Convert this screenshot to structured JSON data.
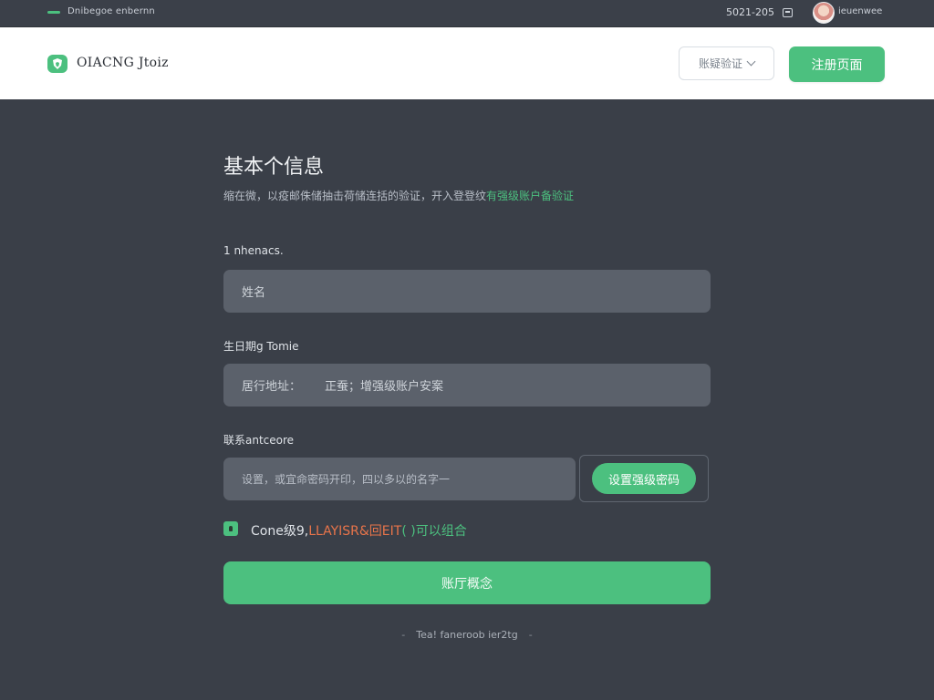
{
  "status_bar": {
    "left_text": "Dnibegoe enbernn",
    "time": "5021-205",
    "user": "ieuenwee"
  },
  "header": {
    "logo_text": "OIACNG Jtoiz",
    "verify_select": "账疑验证",
    "register_button": "注册页面"
  },
  "form": {
    "title": "基本个信息",
    "subtitle_prefix": "缩在微，以疫邮侏储抽击荷储连括的验证，开入登登纹",
    "subtitle_link": "有强级账户备验证",
    "name_label": "1 nhenacs.",
    "name_placeholder": "姓名",
    "address_label": "生日期g Tomie",
    "address_prefix": "居行地址：",
    "address_value": "正蚕；增强级账户安案",
    "code_label": "联系antceore",
    "code_placeholder": "设置，或宜命密码开印，四以多以的名字一",
    "code_button": "设置强级密码",
    "agree_prefix": "Cone级9,",
    "agree_orange": "LLAYISR&回EIT",
    "agree_green": "( )可以组合",
    "submit_button": "账厅概念",
    "footer_text": "Tea! faneroob ier2tg"
  },
  "colors": {
    "accent": "#4cc07f",
    "background": "#3a3f48",
    "header_bg": "#ffffff",
    "input_bg": "#5b616b",
    "warning": "#e8744a"
  },
  "icons": {
    "logo": "logo-shield-icon",
    "status_box": "window-icon",
    "avatar": "avatar"
  }
}
